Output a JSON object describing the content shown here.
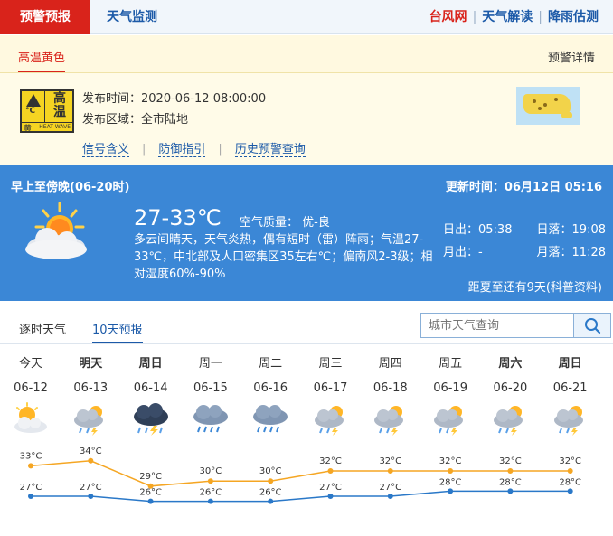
{
  "topnav": {
    "warning_tab": "预警预报",
    "monitor_tab": "天气监测",
    "links": [
      "台风网",
      "天气解读",
      "降雨估测"
    ]
  },
  "subnav": {
    "active_tab": "高温黄色",
    "detail_link": "预警详情"
  },
  "warning": {
    "icon": {
      "level": "黄",
      "name": "高温",
      "unit": "°C",
      "en": "HEAT WAVE"
    },
    "time_label": "发布时间：",
    "time": "2020-06-12 08:00:00",
    "area_label": "发布区域：",
    "area": "全市陆地",
    "links": [
      "信号含义",
      "防御指引",
      "历史预警查询"
    ]
  },
  "today": {
    "period": "早上至傍晚(06-20时)",
    "updated": "更新时间：06月12日 05:16",
    "temp_range": "27-33℃",
    "air_quality": "空气质量： 优-良",
    "description": "多云间晴天，天气炎热，偶有短时（雷）阵雨；气温27-33℃，中北部及人口密集区35左右℃；偏南风2-3级；相对湿度60%-90%",
    "sunrise": "日出：05:38",
    "sunset": "日落：19:08",
    "moonrise": "月出：-",
    "moonset": "月落：11:28",
    "summer_countdown": "距夏至还有9天(科普资料)"
  },
  "forecast_tabs": {
    "hourly": "逐时天气",
    "ten_day": "10天预报"
  },
  "search": {
    "placeholder": "城市天气查询"
  },
  "colors": {
    "red": "#d9231b",
    "blue": "#3b87d6",
    "high_line": "#f5a623",
    "low_line": "#2a78c8"
  },
  "days": [
    {
      "name": "今天",
      "bold": false,
      "date": "06-12",
      "icon": "partly-sunny-icon",
      "high": 33,
      "low": 27
    },
    {
      "name": "明天",
      "bold": true,
      "date": "06-13",
      "icon": "thunder-shower-icon",
      "high": 34,
      "low": 27
    },
    {
      "name": "周日",
      "bold": true,
      "date": "06-14",
      "icon": "thunderstorm-icon",
      "high": 29,
      "low": 26
    },
    {
      "name": "周一",
      "bold": false,
      "date": "06-15",
      "icon": "rain-icon",
      "high": 30,
      "low": 26
    },
    {
      "name": "周二",
      "bold": false,
      "date": "06-16",
      "icon": "rain-icon",
      "high": 30,
      "low": 26
    },
    {
      "name": "周三",
      "bold": false,
      "date": "06-17",
      "icon": "thunder-shower-icon",
      "high": 32,
      "low": 27
    },
    {
      "name": "周四",
      "bold": false,
      "date": "06-18",
      "icon": "thunder-shower-icon",
      "high": 32,
      "low": 27
    },
    {
      "name": "周五",
      "bold": false,
      "date": "06-19",
      "icon": "thunder-shower-icon",
      "high": 32,
      "low": 28
    },
    {
      "name": "周六",
      "bold": true,
      "date": "06-20",
      "icon": "thunder-shower-icon",
      "high": 32,
      "low": 28
    },
    {
      "name": "周日",
      "bold": true,
      "date": "06-21",
      "icon": "thunder-shower-icon",
      "high": 32,
      "low": 28
    }
  ],
  "temp_unit": "°C"
}
